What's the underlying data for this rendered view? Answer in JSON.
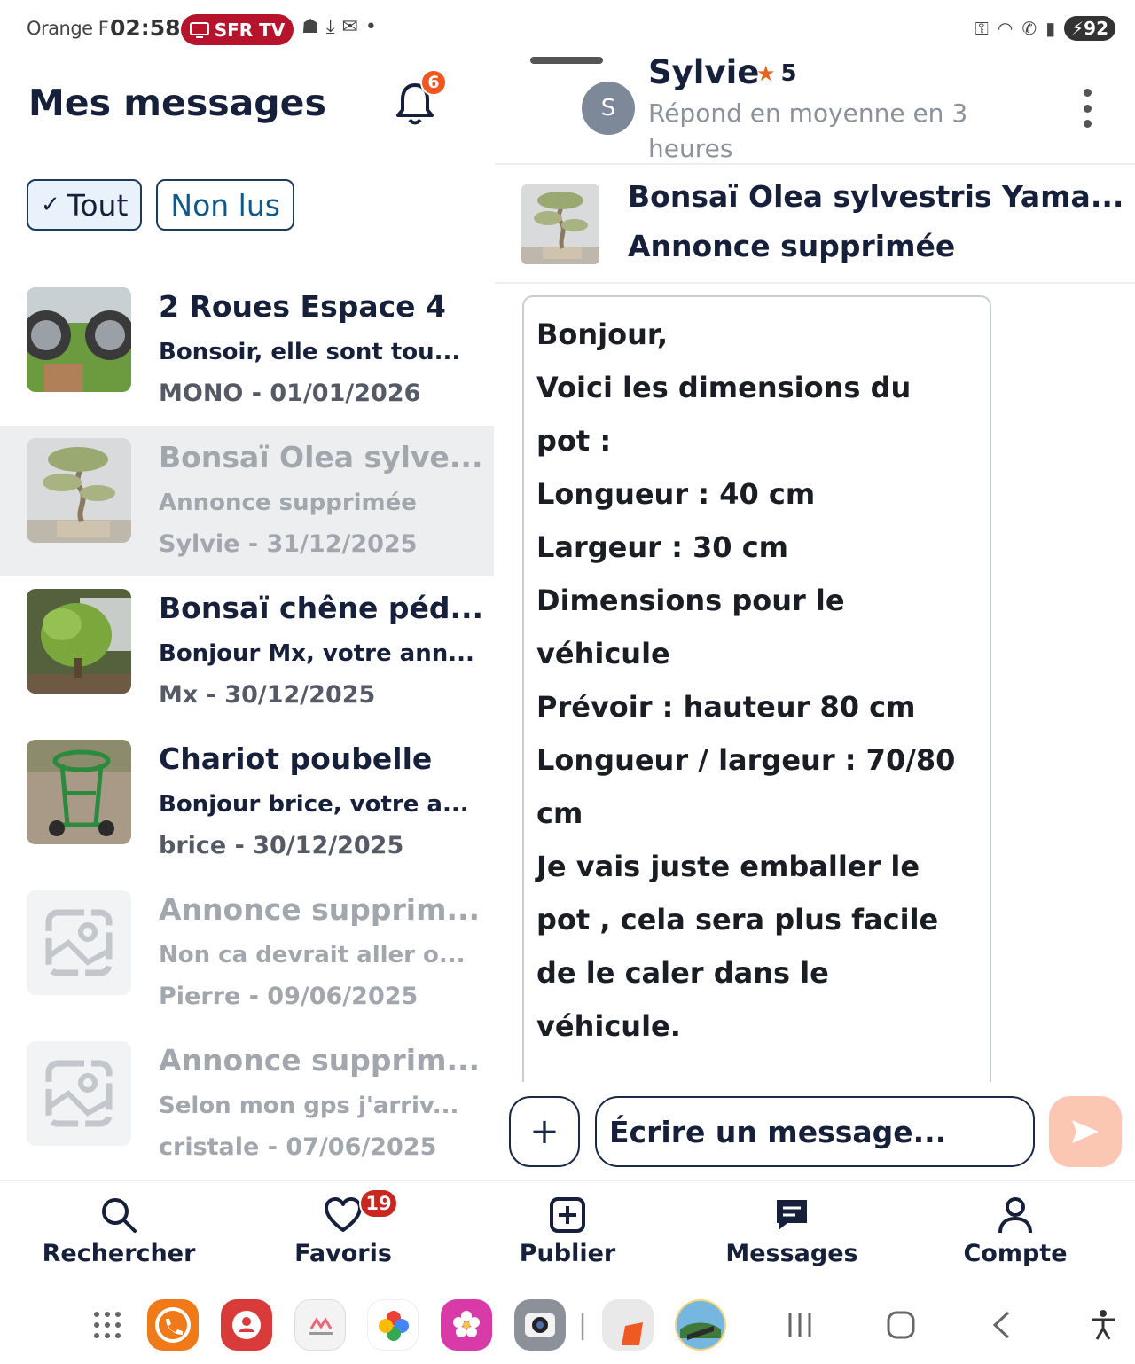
{
  "status_bar": {
    "carrier": "Orange F",
    "time": "02:58",
    "tv_label": "SFR TV",
    "battery": "92"
  },
  "inbox": {
    "title": "Mes messages",
    "notification_count": "6",
    "filters": [
      {
        "label": "Tout",
        "active": true
      },
      {
        "label": "Non lus",
        "active": false
      }
    ],
    "conversations": [
      {
        "title": "2 Roues Espace 4",
        "snippet": "Bonsoir,  elle sont tou...",
        "meta": "MONO - 01/01/2026",
        "image": "wheels-photo",
        "dim": false,
        "selected": false
      },
      {
        "title": "Bonsaï Olea sylve...",
        "snippet": "Annonce supprimée",
        "meta": "Sylvie - 31/12/2025",
        "image": "bonsai-photo",
        "dim": true,
        "selected": true
      },
      {
        "title": "Bonsaï chêne péd...",
        "snippet": "Bonjour Mx, votre ann...",
        "meta": "Mx - 30/12/2025",
        "image": "oak-photo",
        "dim": false,
        "selected": false
      },
      {
        "title": "Chariot poubelle",
        "snippet": "Bonjour brice, votre a...",
        "meta": "brice - 30/12/2025",
        "image": "cart-photo",
        "dim": false,
        "selected": false
      },
      {
        "title": "Annonce supprim...",
        "snippet": "Non ca devrait aller o...",
        "meta": "Pierre - 09/06/2025",
        "image": "placeholder",
        "dim": true,
        "selected": false
      },
      {
        "title": "Annonce supprim...",
        "snippet": "Selon mon gps j'arriv...",
        "meta": "cristale - 07/06/2025",
        "image": "placeholder",
        "dim": true,
        "selected": false
      }
    ]
  },
  "chat": {
    "contact_initial": "S",
    "contact_name": "Sylvie",
    "rating": "5",
    "response_time": "Répond en moyenne en 3 heures",
    "listing_title": "Bonsaï Olea sylvestris Yama...",
    "listing_status": "Annonce supprimée",
    "message_lines": [
      "Bonjour,",
      "Voici les dimensions du",
      "pot :",
      "Longueur : 40 cm",
      "Largeur : 30 cm",
      "",
      "Dimensions pour le",
      "véhicule",
      "Prévoir : hauteur 80 cm",
      "Longueur / largeur : 70/80",
      "cm",
      "Je vais juste emballer le",
      "pot , cela sera plus facile",
      "de le caler dans le véhicule."
    ],
    "composer_placeholder": "Écrire un message...",
    "add_label": "+",
    "send_icon": "send-icon"
  },
  "bottom_nav": {
    "items": [
      {
        "label": "Rechercher",
        "icon": "search-icon"
      },
      {
        "label": "Favoris",
        "icon": "heart-icon"
      },
      {
        "label": "Publier",
        "icon": "plus-square-icon"
      },
      {
        "label": "Messages",
        "icon": "chat-icon"
      },
      {
        "label": "Compte",
        "icon": "user-icon"
      }
    ],
    "favorites_count": "19"
  },
  "colors": {
    "accent": "#f0561d",
    "navy": "#17203a",
    "selected_row": "#edeef0",
    "send_disabled": "#fbc7b3"
  }
}
